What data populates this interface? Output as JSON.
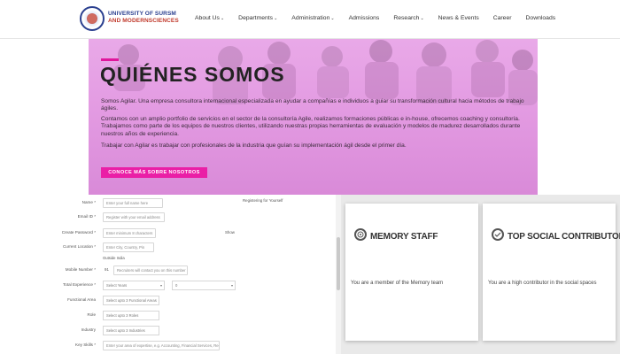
{
  "header": {
    "brand_line1": "UNIVERSITY OF SURSM",
    "brand_line2": "AND MODERNSCIENCES",
    "nav": [
      {
        "label": "About Us",
        "dropdown": true
      },
      {
        "label": "Departments",
        "dropdown": true
      },
      {
        "label": "Administration",
        "dropdown": true
      },
      {
        "label": "Admissions",
        "dropdown": false
      },
      {
        "label": "Research",
        "dropdown": true
      },
      {
        "label": "News & Events",
        "dropdown": false
      },
      {
        "label": "Career",
        "dropdown": false
      },
      {
        "label": "Downloads",
        "dropdown": false
      }
    ]
  },
  "hero": {
    "title": "QUIÉNES SOMOS",
    "p1": "Somos Agilar. Una empresa consultora internacional especializada en ayudar a compañías e individuos a guiar su transformación cultural hacia métodos de trabajo ágiles.",
    "p2": "Contamos con un amplio portfolio de servicios en el sector de la consultoría Agile, realizamos formaciones públicas e in-house, ofrecemos coaching y consultoría. Trabajamos como parte de los equipos de nuestros clientes, utilizando nuestras propias herramientas de evaluación y modelos de madurez desarrollados durante nuestros años de experiencia.",
    "p3": "Trabajar con Agilar es trabajar con profesionales de la industria que guían su implementación ágil desde el primer día.",
    "button": "CONOCE MÁS SOBRE NOSOTROS",
    "accent": "#ea1fa6"
  },
  "form": {
    "right_label": "Registering for Yourself",
    "fields": [
      {
        "label": "Name *",
        "placeholder": "Enter your full name here"
      },
      {
        "label": "Email ID *",
        "placeholder": "Register with your email address"
      },
      {
        "label": "Create Password *",
        "placeholder": "Enter minimum 8 characters",
        "note": "Show"
      },
      {
        "label": "Current Location *",
        "placeholder": "Enter City, Country, Pin"
      },
      {
        "label": "Mobile Number *",
        "prefix": "91",
        "placeholder": "Recruiters will contact you on this number",
        "subnote": "Outside India"
      },
      {
        "label": "Total Experience *",
        "select1": "Select Years",
        "select2": "0"
      },
      {
        "label": "Functional Area",
        "select": "Select upto 3 Functional Areas"
      },
      {
        "label": "Role",
        "select": "Select upto 3 Roles"
      },
      {
        "label": "Industry",
        "select": "Select upto 3 Industries"
      },
      {
        "label": "Key Skills *",
        "placeholder": "Enter your area of expertise, e.g. Accounting, Financial Services, Recruitment"
      }
    ]
  },
  "cards": [
    {
      "title": "MEMORY STAFF",
      "desc": "You are a member of the Memory team",
      "icon": "target-icon"
    },
    {
      "title": "TOP SOCIAL CONTRIBUTOR",
      "desc": "You are a high contributor in the social spaces",
      "icon": "badge-icon"
    }
  ]
}
